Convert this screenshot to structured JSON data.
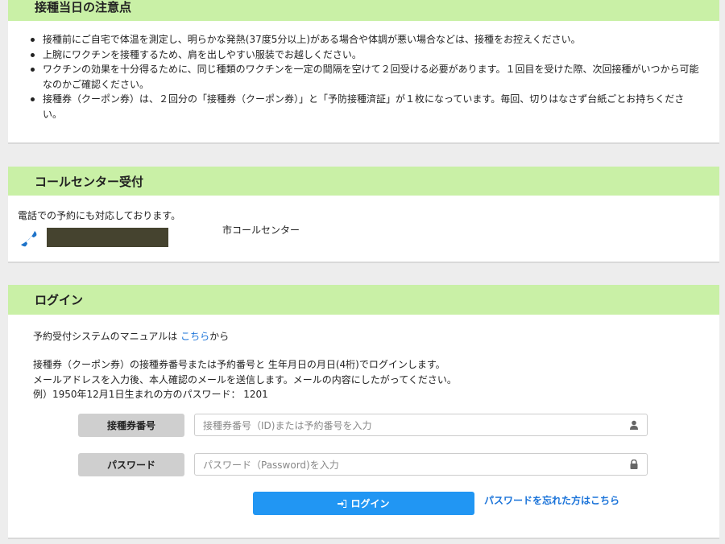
{
  "notes": {
    "title": "接種当日の注意点",
    "items": [
      "接種前にご自宅で体温を測定し、明らかな発熱(37度5分以上)がある場合や体調が悪い場合などは、接種をお控えください。",
      "上腕にワクチンを接種するため、肩を出しやすい服装でお越しください。",
      "ワクチンの効果を十分得るために、同じ種類のワクチンを一定の間隔を空けて２回受ける必要があります。１回目を受けた際、次回接種がいつから可能なのかご確認ください。",
      "接種券（クーポン券）は、２回分の「接種券（クーポン券）」と「予防接種済証」が１枚になっています。毎回、切りはなさず台紙ごとお持ちください。"
    ]
  },
  "call": {
    "title": "コールセンター受付",
    "text": "電話での予約にも対応しております。",
    "center_name": "市コールセンター",
    "icon": "phone-icon"
  },
  "login": {
    "title": "ログイン",
    "manual_prefix": "予約受付システムのマニュアルは",
    "manual_link": "こちら",
    "manual_suffix": "から",
    "info_lines": [
      "接種券（クーポン券）の接種券番号または予約番号と 生年月日の月日(4桁)でログインします。",
      "メールアドレスを入力後、本人確認のメールを送信します。メールの内容にしたがってください。",
      "例）1950年12月1日生まれの方のパスワード： 1201"
    ],
    "id_label": "接種券番号",
    "id_placeholder": "接種券番号（ID)または予約番号を入力",
    "password_label": "パスワード",
    "password_placeholder": "パスワード（Password)を入力",
    "button_label": "ログイン",
    "forgot_link": "パスワードを忘れた方はこちら"
  },
  "colors": {
    "header_green": "#c9f0a6",
    "button_blue": "#2196f3",
    "link_blue": "#1a73d9"
  }
}
